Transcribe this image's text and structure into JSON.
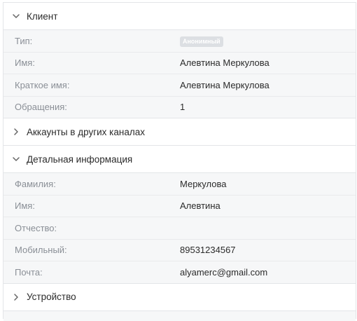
{
  "sections": {
    "client": {
      "title": "Клиент",
      "rows": {
        "type": {
          "label": "Тип:",
          "value": "Анонимный"
        },
        "name": {
          "label": "Имя:",
          "value": "Алевтина Меркулова"
        },
        "short_name": {
          "label": "Краткое имя:",
          "value": "Алевтина Меркулова"
        },
        "requests": {
          "label": "Обращения:",
          "value": "1"
        }
      }
    },
    "accounts": {
      "title": "Аккаунты в других каналах"
    },
    "details": {
      "title": "Детальная информация",
      "rows": {
        "surname": {
          "label": "Фамилия:",
          "value": "Меркулова"
        },
        "first_name": {
          "label": "Имя:",
          "value": "Алевтина"
        },
        "patronymic": {
          "label": "Отчество:",
          "value": ""
        },
        "mobile": {
          "label": "Мобильный:",
          "value": "89531234567"
        },
        "email": {
          "label": "Почта:",
          "value": "alyamerc@gmail.com"
        }
      }
    },
    "device": {
      "title": "Устройство"
    }
  },
  "icons": {
    "expanded": "chevron-down-icon",
    "collapsed": "chevron-right-icon"
  },
  "colors": {
    "label": "#8a8f96",
    "value": "#2b2b2b",
    "row_bg": "#f6f7f8",
    "badge_bg": "#dcdfe3"
  }
}
